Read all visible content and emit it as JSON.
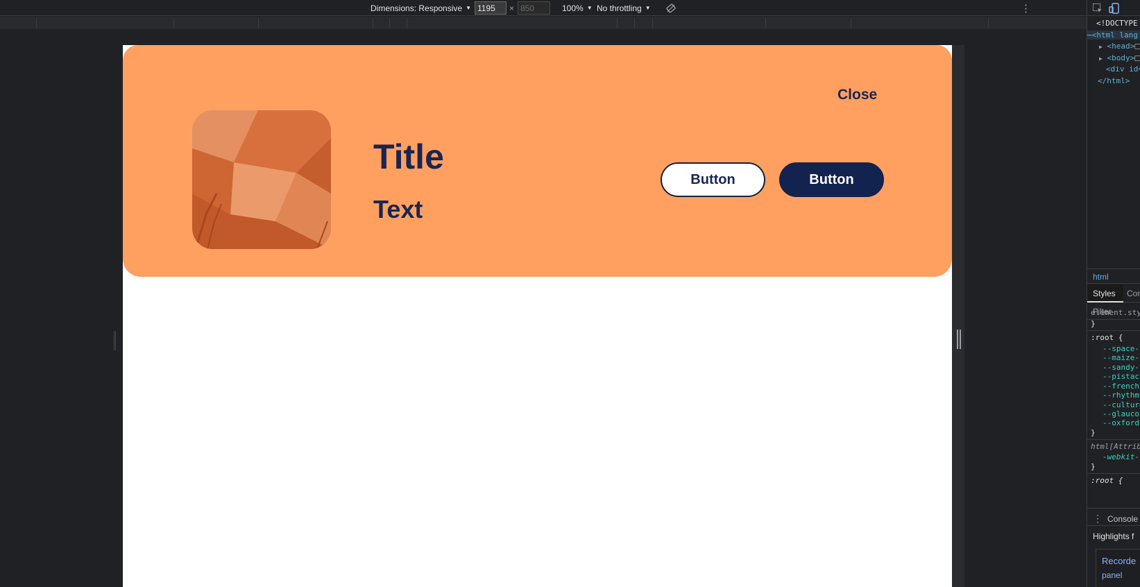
{
  "device_toolbar": {
    "dimensions_label": "Dimensions: Responsive",
    "width_value": "1195",
    "height_placeholder": "850",
    "times": "×",
    "zoom_label": "100%",
    "throttling_label": "No throttling"
  },
  "banner": {
    "title": "Title",
    "text": "Text",
    "close_label": "Close",
    "button_outline_label": "Button",
    "button_filled_label": "Button",
    "background_color": "#ffa060",
    "text_color": "#1a2552"
  },
  "devtools": {
    "dom": {
      "doctype": "<!DOCTYPE",
      "html_open": "<html lang",
      "head": "<head>",
      "body": "<body>",
      "div": "<div id=",
      "html_close": "</html>"
    },
    "breadcrumb": "html",
    "tabs": {
      "styles": "Styles",
      "computed": "Con"
    },
    "filter_placeholder": "Filter",
    "styles": {
      "element_style": "element.styl",
      "close_brace": "}",
      "root_selector": ":root {",
      "vars": [
        "--space-",
        "--maize-",
        "--sandy-",
        "--pistac",
        "--french",
        "--rhythm",
        "--culture",
        "--glaucou",
        "--oxford-"
      ],
      "html_attr_selector": "html[Attrib",
      "webkit_prop": "-webkit-",
      "root_selector_2": ":root {"
    },
    "drawer": {
      "console_tab": "Console",
      "highlights": "Highlights f",
      "recorder": "Recorde",
      "panel": "panel"
    }
  }
}
